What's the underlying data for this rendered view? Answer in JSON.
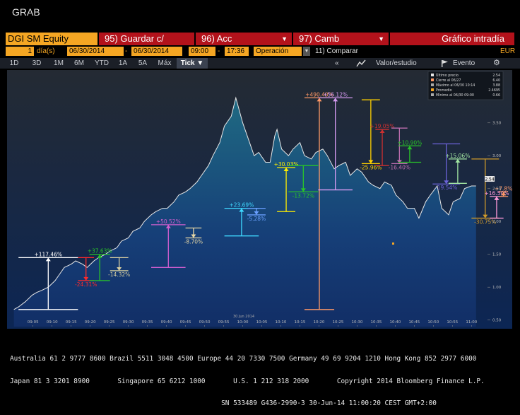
{
  "window": {
    "title": "GRAB"
  },
  "command": {
    "security": "DGI SM Equity",
    "buttons": [
      {
        "num": "95)",
        "label": "Guardar c/"
      },
      {
        "num": "96)",
        "label": "Acc"
      },
      {
        "num": "97)",
        "label": "Camb"
      }
    ],
    "screen_title": "Gráfico intradía"
  },
  "params": {
    "period_count": "1",
    "period_unit": "día(s)",
    "start_date": "06/30/2014",
    "end_date": "06/30/2014",
    "start_time": "09:00",
    "end_time": "17:36",
    "mode": "Operación",
    "compare": "11) Comparar",
    "currency": "EUR"
  },
  "range_tabs": [
    "1D",
    "3D",
    "1M",
    "6M",
    "YTD",
    "1A",
    "5A",
    "Máx",
    "Tick ▼"
  ],
  "active_range": "Tick ▼",
  "toolbar": {
    "collapse": "«",
    "value_study": "Valor/estudio",
    "event": "Evento",
    "gear": "⚙"
  },
  "legend": {
    "items": [
      {
        "label": "Último precio",
        "value": "2.54",
        "color": "#e8e8e8"
      },
      {
        "label": "Cierre al 06/27",
        "value": "6.40",
        "color": "#ff9966"
      },
      {
        "label": "Máximo al 06/30 10:14",
        "value": "3.88",
        "color": "#aaaaaa"
      },
      {
        "label": "Promedio",
        "value": "2.4695",
        "color": "#f5a623"
      },
      {
        "label": "Mínimo al 06/30 09:00",
        "value": "0.66",
        "color": "#aaaaaa"
      }
    ]
  },
  "colors": {
    "accent": "#f5a623",
    "button_red": "#b3121b",
    "up": "#4fa3ff",
    "price_line": "#e8e8e8"
  },
  "chart_data": {
    "type": "area",
    "ylim": [
      0.4,
      4.25
    ],
    "y_ticks": [
      "0.50",
      "1.00",
      "1.50",
      "2.00",
      "2.50",
      "3.00",
      "3.50",
      "4.00"
    ],
    "x_ticks": [
      "09:05",
      "09:10",
      "09:15",
      "09:20",
      "09:25",
      "09:30",
      "09:35",
      "09:40",
      "09:45",
      "09:50",
      "09:55",
      "10:00",
      "10:05",
      "10:10",
      "10:15",
      "10:20",
      "10:25",
      "10:30",
      "10:35",
      "10:40",
      "10:45",
      "10:50",
      "10:55",
      "11:00"
    ],
    "x_date_label": "30 Jun 2014",
    "last_price_tag": "2.54",
    "series": [
      {
        "x": [
          9.0,
          9.02,
          9.05,
          9.08,
          9.1,
          9.12,
          9.15,
          9.18,
          9.2,
          9.22,
          9.25,
          9.27,
          9.3,
          9.32,
          9.35,
          9.37,
          9.4,
          9.42,
          9.45,
          9.47,
          9.5,
          9.52,
          9.55,
          9.57,
          9.6,
          9.62,
          9.65,
          9.67,
          9.7,
          9.72,
          9.75,
          9.77,
          9.8,
          9.82,
          9.85,
          9.87,
          9.9,
          9.92,
          9.95,
          9.97,
          10.0,
          10.02,
          10.05,
          10.07,
          10.1,
          10.12,
          10.14,
          10.15,
          10.17,
          10.2,
          10.22,
          10.25,
          10.27,
          10.3,
          10.32,
          10.35,
          10.37,
          10.4,
          10.42,
          10.45,
          10.47,
          10.5,
          10.52,
          10.55,
          10.57,
          10.6,
          10.62,
          10.65,
          10.67,
          10.7,
          10.72,
          10.75,
          10.77,
          10.8,
          10.82,
          10.85,
          10.87,
          10.9,
          10.92,
          10.95,
          10.97,
          11.0,
          11.02
        ],
        "values": [
          0.66,
          0.7,
          0.78,
          0.88,
          0.92,
          0.95,
          1.0,
          1.1,
          1.2,
          1.3,
          1.35,
          1.4,
          1.35,
          1.3,
          1.4,
          1.45,
          1.5,
          1.55,
          1.6,
          1.7,
          1.75,
          1.85,
          1.9,
          2.0,
          2.1,
          2.15,
          2.2,
          2.2,
          2.3,
          2.4,
          2.45,
          2.5,
          2.6,
          2.7,
          2.85,
          3.0,
          3.2,
          3.45,
          3.6,
          3.88,
          3.5,
          3.3,
          3.0,
          3.05,
          2.9,
          2.9,
          3.3,
          3.4,
          3.1,
          3.0,
          3.1,
          3.2,
          3.0,
          2.95,
          3.05,
          3.1,
          3.0,
          2.8,
          2.85,
          2.9,
          2.7,
          2.8,
          2.75,
          2.6,
          2.55,
          2.5,
          2.6,
          2.55,
          2.4,
          2.3,
          2.2,
          2.2,
          2.05,
          2.3,
          2.4,
          2.54,
          2.2,
          2.1,
          2.3,
          2.35,
          2.5,
          2.54,
          2.54
        ]
      }
    ],
    "markers": [
      {
        "label": "+117.46%",
        "x1": 9.02,
        "x2": 9.28,
        "yfrom": 0.66,
        "yto": 1.45,
        "color": "#ffffff"
      },
      {
        "label": "-24.31%",
        "x1": 9.28,
        "x2": 9.35,
        "yfrom": 1.45,
        "yto": 1.1,
        "color": "#ff2a2a"
      },
      {
        "label": "+37.63%",
        "x1": 9.33,
        "x2": 9.42,
        "yfrom": 1.1,
        "yto": 1.5,
        "color": "#29c429"
      },
      {
        "label": "-14.32%",
        "x1": 9.42,
        "x2": 9.5,
        "yfrom": 1.45,
        "yto": 1.25,
        "color": "#d8cfa0"
      },
      {
        "label": "+50.52%",
        "x1": 9.6,
        "x2": 9.75,
        "yfrom": 1.3,
        "yto": 1.95,
        "color": "#d25fd0"
      },
      {
        "label": "-8.70%",
        "x1": 9.75,
        "x2": 9.82,
        "yfrom": 1.9,
        "yto": 1.75,
        "color": "#e6d7a6"
      },
      {
        "label": "+23.69%",
        "x1": 9.92,
        "x2": 10.07,
        "yfrom": 1.78,
        "yto": 2.2,
        "color": "#3fd8ff"
      },
      {
        "label": "-5.28%",
        "x1": 10.02,
        "x2": 10.1,
        "yfrom": 2.2,
        "yto": 2.1,
        "color": "#6aa0ff"
      },
      {
        "label": "+30.03%",
        "x1": 10.15,
        "x2": 10.23,
        "yfrom": 2.15,
        "yto": 2.82,
        "color": "#ffee00"
      },
      {
        "label": "-13.72%",
        "x1": 10.2,
        "x2": 10.33,
        "yfrom": 2.85,
        "yto": 2.45,
        "color": "#29c429"
      },
      {
        "label": "+490.40%",
        "x1": 10.27,
        "x2": 10.4,
        "yfrom": 0.66,
        "yto": 3.88,
        "color": "#ff9966"
      },
      {
        "label": "+56.12%",
        "x1": 10.33,
        "x2": 10.48,
        "yfrom": 2.48,
        "yto": 3.88,
        "color": "#d69bf2"
      },
      {
        "label": "-25.96%",
        "x1": 10.52,
        "x2": 10.6,
        "yfrom": 3.85,
        "yto": 2.88,
        "color": "#ffd000"
      },
      {
        "label": "+19.05%",
        "x1": 10.58,
        "x2": 10.64,
        "yfrom": 2.85,
        "yto": 3.4,
        "color": "#cc3030"
      },
      {
        "label": "-16.40%",
        "x1": 10.65,
        "x2": 10.72,
        "yfrom": 3.42,
        "yto": 2.88,
        "color": "#c06fb0"
      },
      {
        "label": "+10.90%",
        "x1": 10.68,
        "x2": 10.78,
        "yfrom": 2.9,
        "yto": 3.15,
        "color": "#29c429"
      },
      {
        "label": "-19.54%",
        "x1": 10.83,
        "x2": 10.95,
        "yfrom": 3.18,
        "yto": 2.57,
        "color": "#6c63d9"
      },
      {
        "label": "+15.06%",
        "x1": 10.9,
        "x2": 10.98,
        "yfrom": 2.58,
        "yto": 2.95,
        "color": "#a3e8a3"
      },
      {
        "label": "-30.75%",
        "x1": 11.0,
        "x2": 11.12,
        "yfrom": 2.95,
        "yto": 2.05,
        "color": "#d09a2a"
      },
      {
        "label": "+16.50%",
        "x1": 11.08,
        "x2": 11.14,
        "yfrom": 2.05,
        "yto": 2.38,
        "color": "#ff9ad9"
      },
      {
        "label": "+7.8%",
        "x1": 11.12,
        "x2": 11.16,
        "yfrom": 2.38,
        "yto": 2.45,
        "color": "#ff9966"
      }
    ]
  },
  "footer": {
    "line1": "Australia 61 2 9777 8600 Brazil 5511 3048 4500 Europe 44 20 7330 7500 Germany 49 69 9204 1210 Hong Kong 852 2977 6000",
    "line2": "Japan 81 3 3201 8900       Singapore 65 6212 1000       U.S. 1 212 318 2000       Copyright 2014 Bloomberg Finance L.P.",
    "line3": "                                                     SN 533489 G436-2990-3 30-Jun-14 11:00:20 CEST GMT+2:00"
  }
}
